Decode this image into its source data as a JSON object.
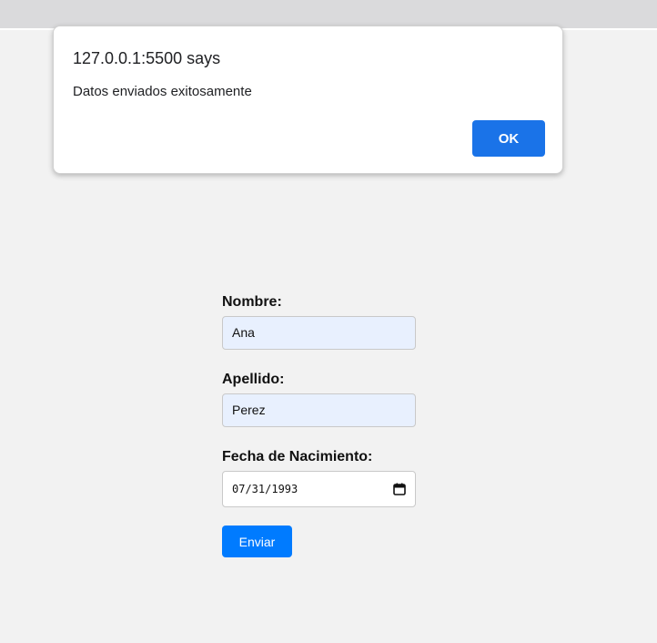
{
  "dialog": {
    "title": "127.0.0.1:5500 says",
    "message": "Datos enviados exitosamente",
    "ok_label": "OK"
  },
  "form": {
    "nombre": {
      "label": "Nombre:",
      "value": "Ana"
    },
    "apellido": {
      "label": "Apellido:",
      "value": "Perez"
    },
    "fecha": {
      "label": "Fecha de Nacimiento:",
      "value": "07/31/1993"
    },
    "submit_label": "Enviar"
  },
  "icons": {
    "date_picker": "calendar-icon"
  },
  "colors": {
    "page_bg": "#f2f2f2",
    "topbar_bg": "#dadadc",
    "autofill_bg": "#e8f0fe",
    "submit_btn": "#007bff",
    "dialog_ok_btn": "#1a73e8"
  }
}
